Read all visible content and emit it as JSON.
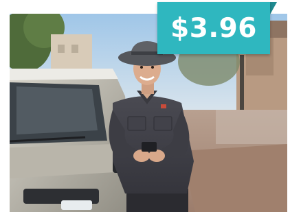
{
  "price": {
    "label": "$3.96",
    "badge_color": "#2fb7bf"
  },
  "photo": {
    "icon": "person-with-phone-and-vehicle-photo"
  }
}
